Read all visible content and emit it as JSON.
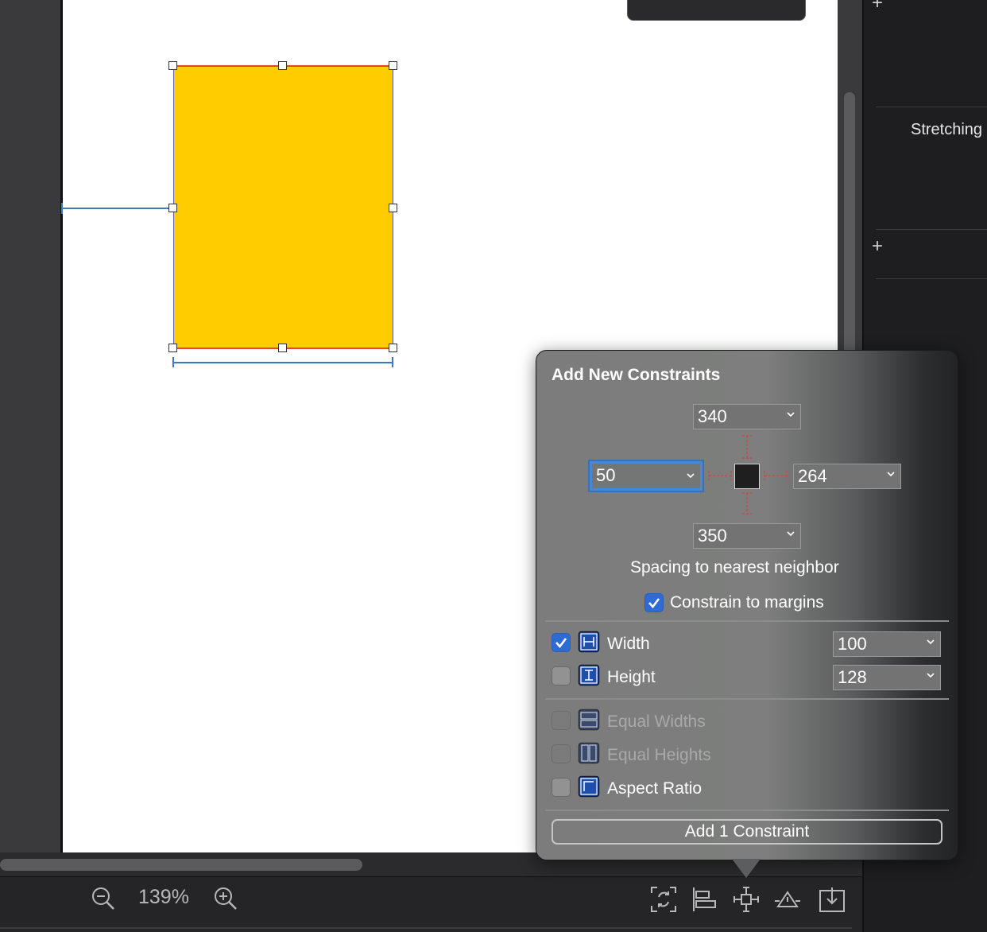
{
  "canvas": {
    "zoom_level": "139%",
    "selected_view_color": "#ffcc00"
  },
  "inspector": {
    "stretching_label": "Stretching"
  },
  "popover": {
    "title": "Add New Constraints",
    "spacing": {
      "top": "340",
      "leading": "50",
      "trailing": "264",
      "bottom": "350"
    },
    "spacing_caption": "Spacing to nearest neighbor",
    "constrain_to_margins": {
      "label": "Constrain to margins",
      "checked": true
    },
    "width": {
      "label": "Width",
      "value": "100",
      "checked": true
    },
    "height": {
      "label": "Height",
      "value": "128",
      "checked": false
    },
    "equal_widths": {
      "label": "Equal Widths",
      "enabled": false
    },
    "equal_heights": {
      "label": "Equal Heights",
      "enabled": false
    },
    "aspect_ratio": {
      "label": "Aspect Ratio",
      "checked": false
    },
    "add_button_label": "Add 1 Constraint"
  },
  "toolbar": {
    "icons": [
      "zoom-out-icon",
      "zoom-in-icon",
      "update-frames-icon",
      "align-icon",
      "add-constraints-icon",
      "resolve-issues-icon",
      "embed-in-icon"
    ]
  },
  "colors": {
    "accent": "#2f6bd5",
    "constraint_blue": "#3f77c4",
    "selection_red": "#e0452d"
  }
}
